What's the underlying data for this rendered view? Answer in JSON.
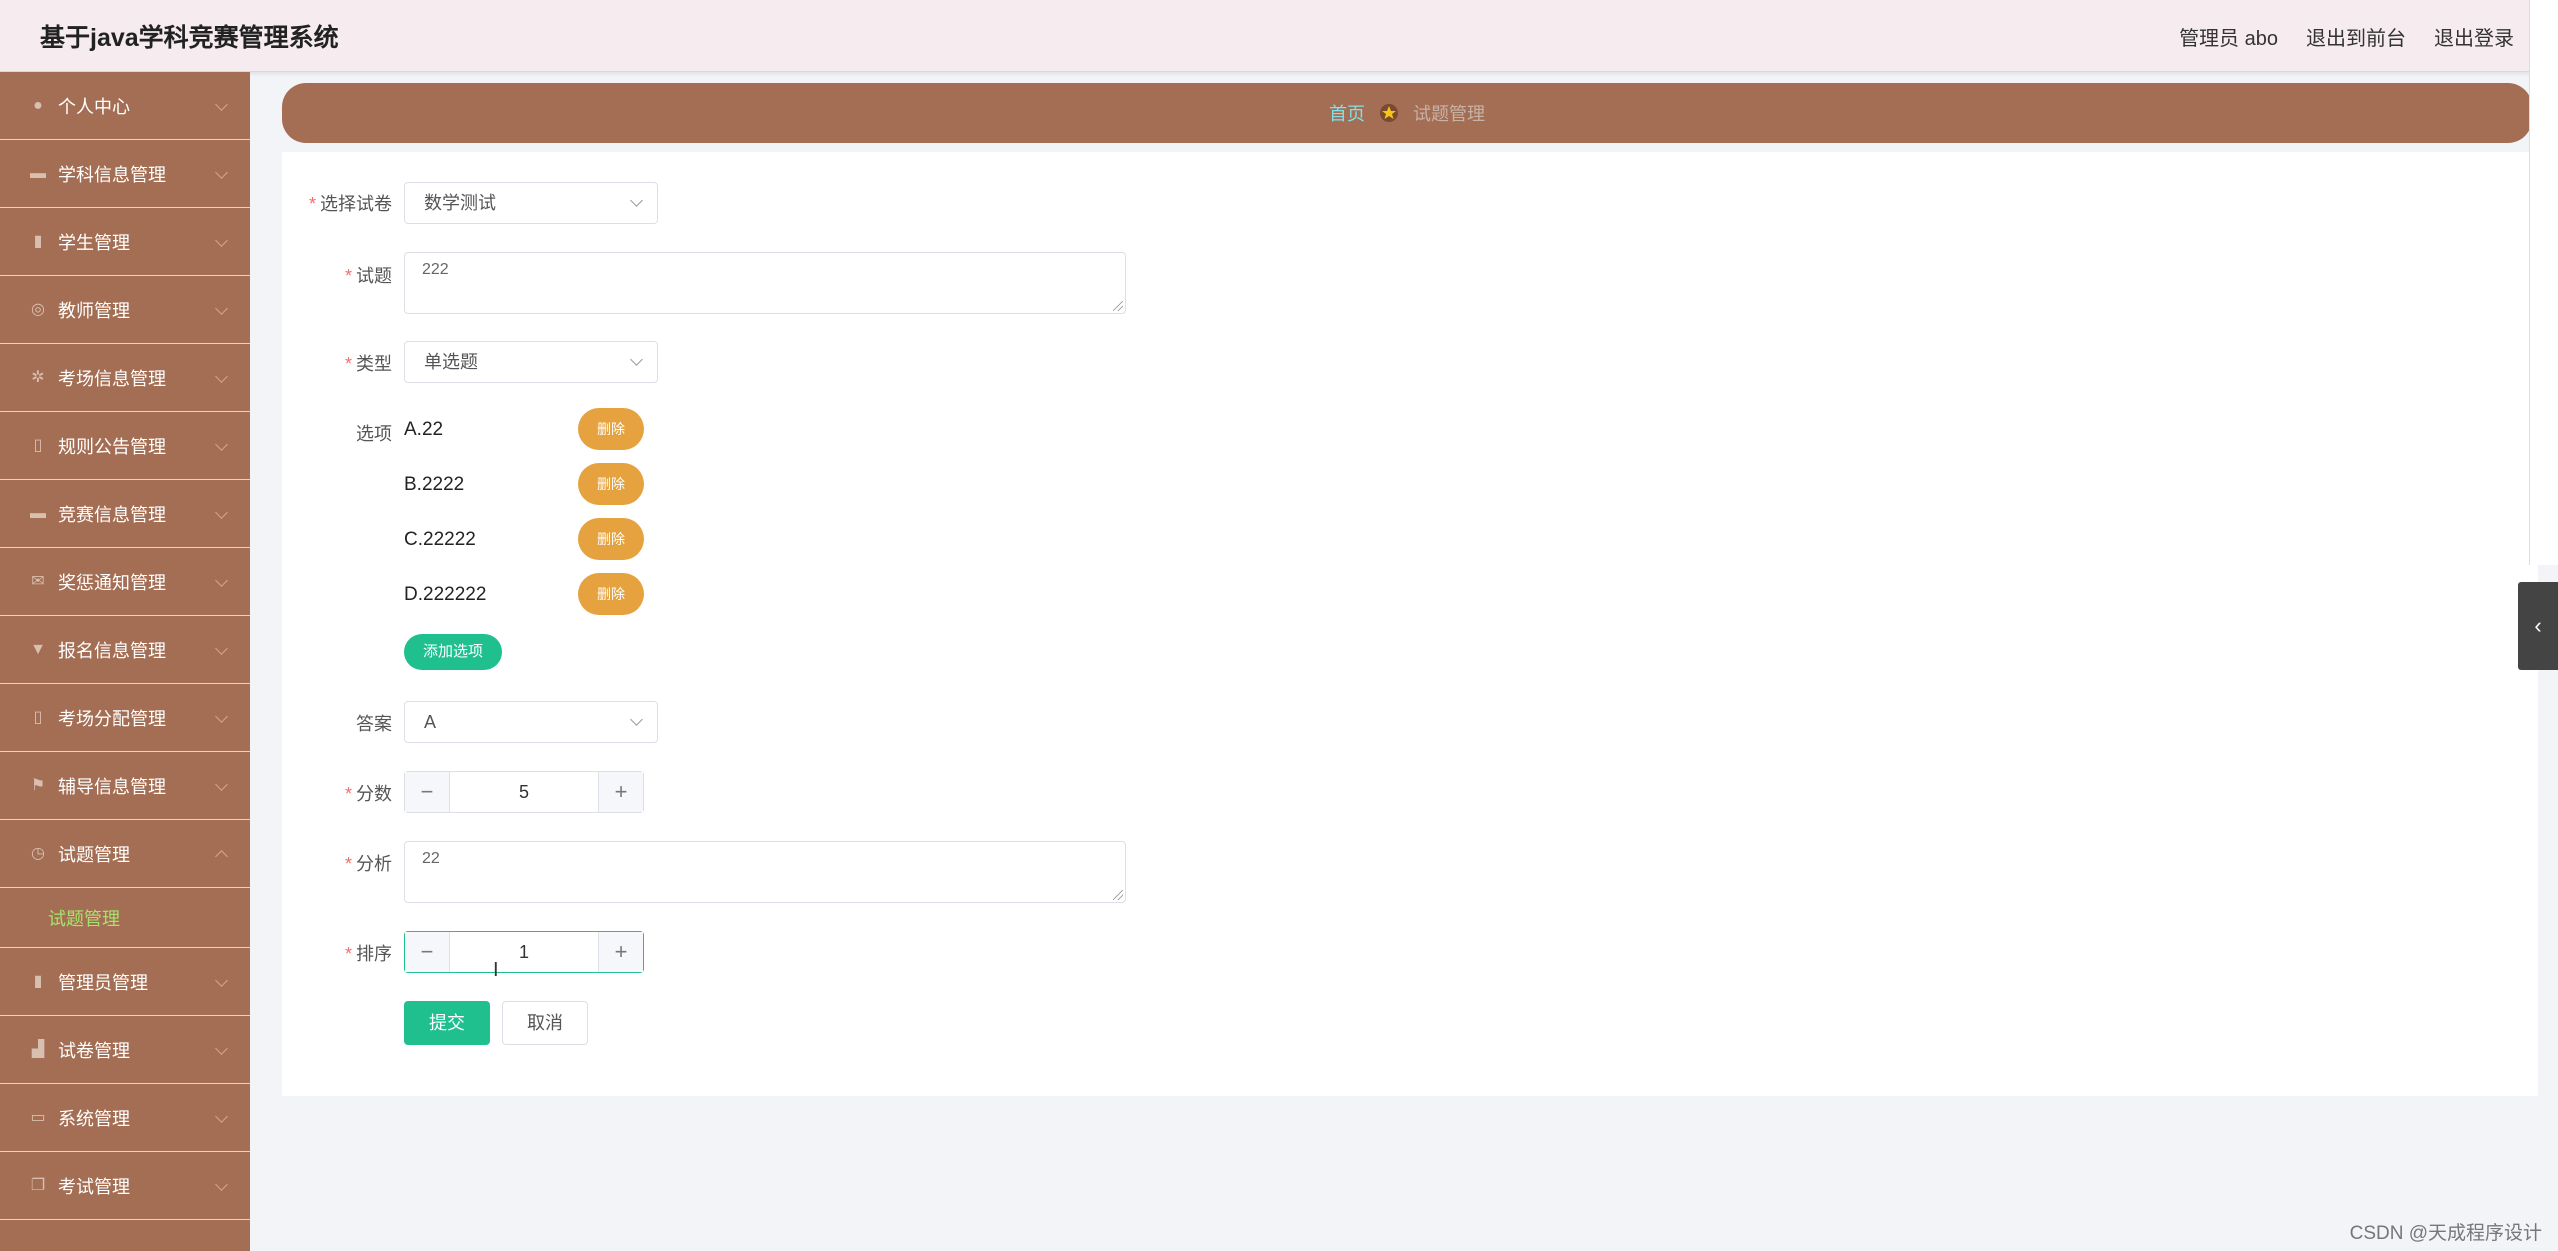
{
  "header": {
    "title": "基于java学科竞赛管理系统",
    "user": "管理员 abo",
    "to_front": "退出到前台",
    "logout": "退出登录"
  },
  "sidebar": {
    "items": [
      {
        "label": "个人中心",
        "icon": "user-icon"
      },
      {
        "label": "学科信息管理",
        "icon": "chat-icon"
      },
      {
        "label": "学生管理",
        "icon": "chart-icon"
      },
      {
        "label": "教师管理",
        "icon": "globe-icon"
      },
      {
        "label": "考场信息管理",
        "icon": "gear-icon"
      },
      {
        "label": "规则公告管理",
        "icon": "mic-icon"
      },
      {
        "label": "竞赛信息管理",
        "icon": "briefcase-icon"
      },
      {
        "label": "奖惩通知管理",
        "icon": "mail-icon"
      },
      {
        "label": "报名信息管理",
        "icon": "trophy-icon"
      },
      {
        "label": "考场分配管理",
        "icon": "mic-icon"
      },
      {
        "label": "辅导信息管理",
        "icon": "flag-icon"
      },
      {
        "label": "试题管理",
        "icon": "clock-icon"
      },
      {
        "label": "管理员管理",
        "icon": "trash-icon"
      },
      {
        "label": "试卷管理",
        "icon": "chart-icon"
      },
      {
        "label": "系统管理",
        "icon": "monitor-icon"
      },
      {
        "label": "考试管理",
        "icon": "copy-icon"
      }
    ],
    "sub_active": "试题管理"
  },
  "breadcrumb": {
    "home": "首页",
    "current": "试题管理"
  },
  "form": {
    "paper_label": "选择试卷",
    "paper_value": "数学测试",
    "question_label": "试题",
    "question_value": "222",
    "type_label": "类型",
    "type_value": "单选题",
    "options_label": "选项",
    "options": [
      "A.22",
      "B.2222",
      "C.22222",
      "D.222222"
    ],
    "delete_label": "删除",
    "add_option_label": "添加选项",
    "answer_label": "答案",
    "answer_value": "A",
    "score_label": "分数",
    "score_value": "5",
    "analysis_label": "分析",
    "analysis_value": "22",
    "sort_label": "排序",
    "sort_value": "1",
    "submit_label": "提交",
    "cancel_label": "取消"
  },
  "watermark": "CSDN @天成程序设计",
  "colors": {
    "sidebar_bg": "#a46e54",
    "accent_green": "#1fc08e",
    "delete_orange": "#e5a23e",
    "header_bg": "#f6ebee"
  }
}
